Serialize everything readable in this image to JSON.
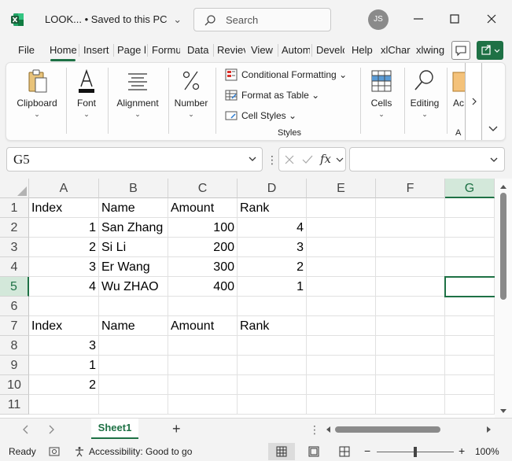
{
  "window": {
    "title": "LOOK...  •  Saved to this PC",
    "title_chevron": "⌄",
    "search_placeholder": "Search",
    "user_initials": "JS",
    "accent": "#1e7145"
  },
  "menu_tabs": [
    {
      "label": "File"
    },
    {
      "label": "Home",
      "active": true
    },
    {
      "label": "Insert"
    },
    {
      "label": "Page l"
    },
    {
      "label": "Formu"
    },
    {
      "label": "Data"
    },
    {
      "label": "Reviev"
    },
    {
      "label": "View"
    },
    {
      "label": "Autom"
    },
    {
      "label": "Develc"
    },
    {
      "label": "Help"
    },
    {
      "label": "xlChar"
    },
    {
      "label": "xlwing"
    }
  ],
  "ribbon": {
    "clipboard": "Clipboard",
    "font": "Font",
    "alignment": "Alignment",
    "number": "Number",
    "conditional_formatting": "Conditional Formatting",
    "format_as_table": "Format as Table",
    "cell_styles": "Cell Styles",
    "styles_group": "Styles",
    "cells": "Cells",
    "editing": "Editing",
    "addins_cut": "Ac",
    "addins_caption_cut": "A"
  },
  "formula_bar": {
    "name_box": "G5",
    "formula": ""
  },
  "sheet": {
    "columns": [
      "A",
      "B",
      "C",
      "D",
      "E",
      "F",
      "G"
    ],
    "selected_column": "G",
    "rows": [
      "1",
      "2",
      "3",
      "4",
      "5",
      "6",
      "7",
      "8",
      "9",
      "10",
      "11"
    ],
    "selected_row": "5",
    "cells": {
      "r1": [
        "Index",
        "Name",
        "Amount",
        "Rank"
      ],
      "r2": [
        "1",
        "San Zhang",
        "100",
        "4"
      ],
      "r3": [
        "2",
        "Si Li",
        "200",
        "3"
      ],
      "r4": [
        "3",
        "Er Wang",
        "300",
        "2"
      ],
      "r5": [
        "4",
        "Wu ZHAO",
        "400",
        "1"
      ],
      "r7": [
        "Index",
        "Name",
        "Amount",
        "Rank"
      ],
      "r8": [
        "3"
      ],
      "r9": [
        "1"
      ],
      "r10": [
        "2"
      ]
    }
  },
  "sheet_tabs": {
    "active": "Sheet1",
    "add": "+"
  },
  "status": {
    "ready": "Ready",
    "accessibility": "Accessibility: Good to go",
    "zoom": "100%",
    "zoom_minus": "−",
    "zoom_plus": "+"
  }
}
